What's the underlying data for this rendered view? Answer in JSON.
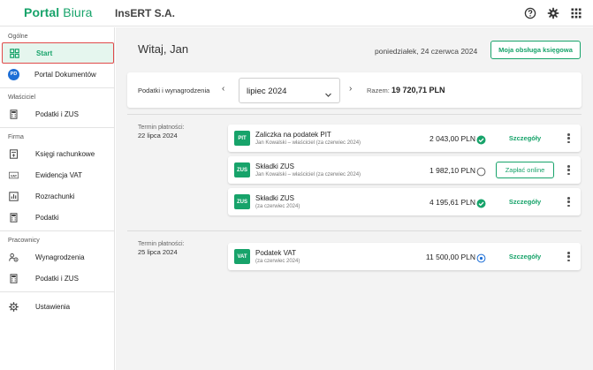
{
  "header": {
    "logo_part1": "Portal",
    "logo_part2": "Biura",
    "company": "InsERT S.A.",
    "icons": [
      "help-icon",
      "gear-icon",
      "apps-grid-icon"
    ]
  },
  "sidebar": {
    "sections": [
      {
        "title": "Ogólne",
        "items": [
          {
            "label": "Start",
            "icon": "dashboard-icon",
            "active": true
          },
          {
            "label": "Portal Dokumentów",
            "icon": "pd-badge-icon",
            "badge": "PD"
          }
        ]
      },
      {
        "title": "Właściciel",
        "items": [
          {
            "label": "Podatki i ZUS",
            "icon": "calculator-icon"
          }
        ]
      },
      {
        "title": "Firma",
        "items": [
          {
            "label": "Księgi rachunkowe",
            "icon": "ledger-icon"
          },
          {
            "label": "Ewidencja VAT",
            "icon": "vat-icon",
            "icon_text": "VAT"
          },
          {
            "label": "Rozrachunki",
            "icon": "chart-icon"
          },
          {
            "label": "Podatki",
            "icon": "calculator-icon"
          }
        ]
      },
      {
        "title": "Pracownicy",
        "items": [
          {
            "label": "Wynagrodzenia",
            "icon": "payroll-icon"
          },
          {
            "label": "Podatki i ZUS",
            "icon": "calculator-icon"
          }
        ]
      },
      {
        "title": "",
        "items": [
          {
            "label": "Ustawienia",
            "icon": "gear-icon"
          }
        ]
      }
    ]
  },
  "main": {
    "greeting": "Witaj, Jan",
    "date": "poniedziałek, 24 czerwca 2024",
    "accountant_button": "Moja obsługa księgowa",
    "filter": {
      "label": "Podatki i wynagrodzenia",
      "month": "lipiec 2024",
      "total_label": "Razem:",
      "total_value": "19 720,71 PLN"
    },
    "groups": [
      {
        "term_label": "Termin płatności:",
        "term_date": "22 lipca 2024",
        "items": [
          {
            "tag": "PIT",
            "title": "Zaliczka na podatek PIT",
            "subtitle": "Jan Kowalski – właściciel (za czerwiec 2024)",
            "amount": "2 043,00 PLN",
            "status": "paid",
            "action": "Szczegóły"
          },
          {
            "tag": "ZUS",
            "title": "Składki ZUS",
            "subtitle": "Jan Kowalski – właściciel (za czerwiec 2024)",
            "amount": "1 982,10 PLN",
            "status": "unpaid",
            "action": "Zapłać online"
          },
          {
            "tag": "ZUS",
            "title": "Składki ZUS",
            "subtitle": "(za czerwiec 2024)",
            "amount": "4 195,61 PLN",
            "status": "paid",
            "action": "Szczegóły"
          }
        ]
      },
      {
        "term_label": "Termin płatności:",
        "term_date": "25 lipca 2024",
        "items": [
          {
            "tag": "VAT",
            "title": "Podatek VAT",
            "subtitle": "(za czerwiec 2024)",
            "amount": "11 500,00 PLN",
            "status": "info",
            "action": "Szczegóły"
          }
        ]
      }
    ]
  },
  "colors": {
    "brand": "#17a36a",
    "active_bg": "#e5f6ee",
    "highlight": "#e04a4a",
    "pd_badge": "#1e6fd6",
    "info": "#1e6fd6"
  }
}
